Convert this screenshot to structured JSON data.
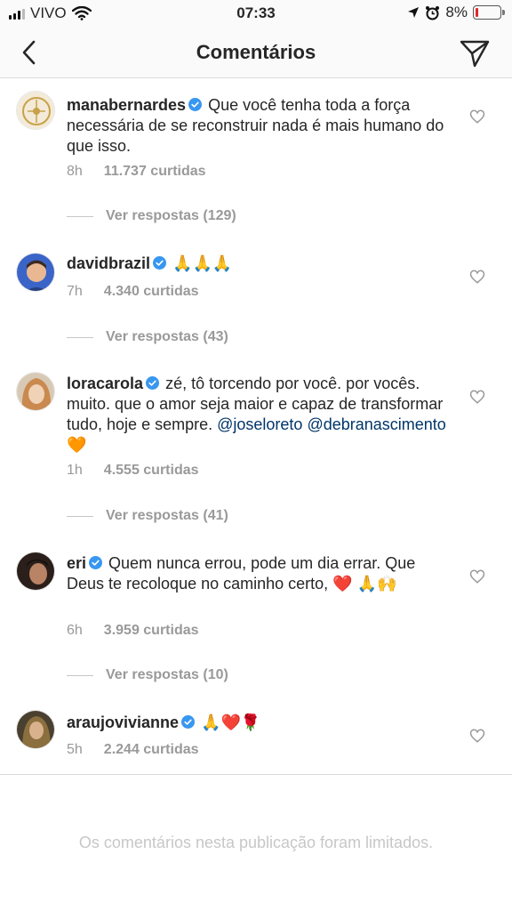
{
  "status_bar": {
    "carrier": "VIVO",
    "time": "07:33",
    "battery": "8%"
  },
  "header": {
    "title": "Comentários"
  },
  "comments": [
    {
      "username": "manabernardes",
      "text": "Que você tenha toda a força necessária de se reconstruir nada é mais humano do que isso.",
      "time": "8h",
      "likes": "11.737 curtidas",
      "replies": "Ver respostas (129)"
    },
    {
      "username": "davidbrazil",
      "text": "🙏🙏🙏",
      "time": "7h",
      "likes": "4.340 curtidas",
      "replies": "Ver respostas (43)"
    },
    {
      "username": "loracarola",
      "text": "zé, tô torcendo por você. por vocês. muito. que o amor seja maior e capaz de transformar tudo, hoje e sempre.",
      "mentions": "@joseloreto @debranascimento",
      "emoji": "🧡",
      "time": "1h",
      "likes": "4.555 curtidas",
      "replies": "Ver respostas (41)"
    },
    {
      "username": "eri",
      "text": "Quem nunca errou, pode um dia errar. Que Deus te recoloque no caminho certo, ❤️ 🙏🙌",
      "time": "6h",
      "likes": "3.959 curtidas",
      "replies": "Ver respostas (10)"
    },
    {
      "username": "araujovivianne",
      "text": "🙏❤️🌹",
      "time": "5h",
      "likes": "2.244 curtidas"
    }
  ],
  "footer": {
    "limited_text": "Os comentários nesta publicação foram limitados."
  },
  "colors": {
    "text": "#262626",
    "secondary": "#999999",
    "verified": "#3897f0",
    "mention": "#003569",
    "divider": "#dbdbdb"
  },
  "icons": [
    "back-chevron-icon",
    "direct-send-icon",
    "verified-badge-icon",
    "heart-outline-icon",
    "wifi-icon",
    "location-arrow-icon",
    "alarm-icon",
    "battery-icon"
  ]
}
